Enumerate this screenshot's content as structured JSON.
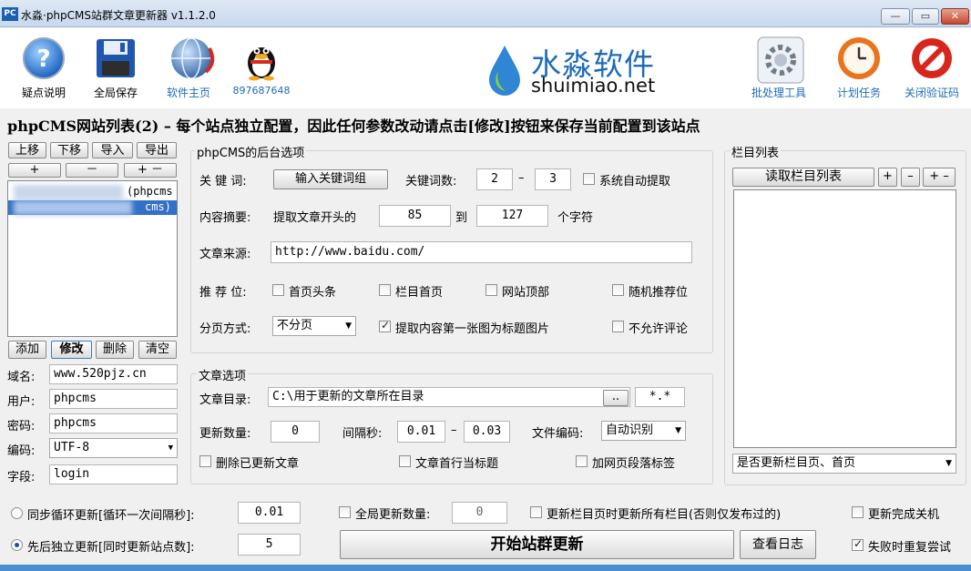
{
  "window": {
    "title": "水淼·phpCMS站群文章更新器 v1.1.2.0",
    "icon_text": "PC"
  },
  "toolbar": {
    "items": [
      {
        "label": "疑点说明",
        "icon": "help-icon"
      },
      {
        "label": "全局保存",
        "icon": "floppy-save-icon"
      },
      {
        "label": "软件主页",
        "icon": "globe-icon"
      },
      {
        "label": "897687648",
        "icon": "qq-penguin-icon"
      },
      {
        "label": "批处理工具",
        "icon": "gear-tool-icon"
      },
      {
        "label": "计划任务",
        "icon": "clock-icon"
      },
      {
        "label": "关闭验证码",
        "icon": "prohibited-icon"
      }
    ],
    "logo_cn": "水淼软件",
    "logo_en": "shuimiao.net"
  },
  "headline": "phpCMS网站列表(2) – 每个站点独立配置，因此任何参数改动请点击[修改]按钮来保存当前配置到该站点",
  "sitelist": {
    "buttons_top": [
      "上移",
      "下移",
      "导入",
      "导出"
    ],
    "buttons_small": [
      "+",
      "－",
      "+ －"
    ],
    "items": [
      "(phpcms",
      "cms)"
    ],
    "buttons_bottom": [
      "添加",
      "修改",
      "删除",
      "清空"
    ]
  },
  "site_fields": [
    {
      "label": "域名:",
      "value": "www.520pjz.cn"
    },
    {
      "label": "用户:",
      "value": "phpcms"
    },
    {
      "label": "密码:",
      "value": "phpcms"
    },
    {
      "label": "编码:",
      "value": "UTF-8"
    },
    {
      "label": "字段:",
      "value": "login"
    }
  ],
  "backend": {
    "title": "phpCMS的后台选项",
    "keyword_label": "关 键 词:",
    "keyword_button": "输入关键词组",
    "keyword_count_label": "关键词数:",
    "keyword_min": "2",
    "dash": "–",
    "keyword_max": "3",
    "auto_extract": "系统自动提取",
    "summary_label": "内容摘要:",
    "summary_prefix": "提取文章开头的",
    "summary_from": "85",
    "summary_to_word": "到",
    "summary_to": "127",
    "summary_unit": "个字符",
    "source_label": "文章来源:",
    "source_value": "http://www.baidu.com/",
    "recommend_label": "推 荐 位:",
    "recommend": [
      "首页头条",
      "栏目首页",
      "网站顶部",
      "随机推荐位"
    ],
    "paging_label": "分页方式:",
    "paging_value": "不分页",
    "first_image": "提取内容第一张图为标题图片",
    "no_comment": "不允许评论"
  },
  "article": {
    "title": "文章选项",
    "dir_label": "文章目录:",
    "dir_value": "C:\\用于更新的文章所在目录",
    "browse": "..",
    "ext": "*.*",
    "count_label": "更新数量:",
    "count_value": "0",
    "interval_label": "间隔秒:",
    "interval_min": "0.01",
    "interval_dash": "–",
    "interval_max": "0.03",
    "encoding_label": "文件编码:",
    "encoding_value": "自动识别",
    "delete_updated": "删除已更新文章",
    "first_line_title": "文章首行当标题",
    "add_paragraph_tags": "加网页段落标签"
  },
  "categories": {
    "title": "栏目列表",
    "read_button": "读取栏目列表",
    "small_buttons": [
      "+",
      "–",
      "+ –"
    ],
    "update_option": "是否更新栏目页、首页"
  },
  "bottom": {
    "sync_label": "同步循环更新[循环一次间隔秒]:",
    "sync_value": "0.01",
    "seq_label": "先后独立更新[同时更新站点数]:",
    "seq_value": "5",
    "global_count_label": "全局更新数量:",
    "global_count_value": "0",
    "update_all_categories": "更新栏目页时更新所有栏目(否则仅发布过的)",
    "shutdown": "更新完成关机",
    "retry": "失败时重复尝试",
    "start_button": "开始站群更新",
    "log_button": "查看日志"
  },
  "colors": {
    "accent": "#1e6bb8",
    "selection": "#3470c8",
    "close": "#c4472e"
  }
}
